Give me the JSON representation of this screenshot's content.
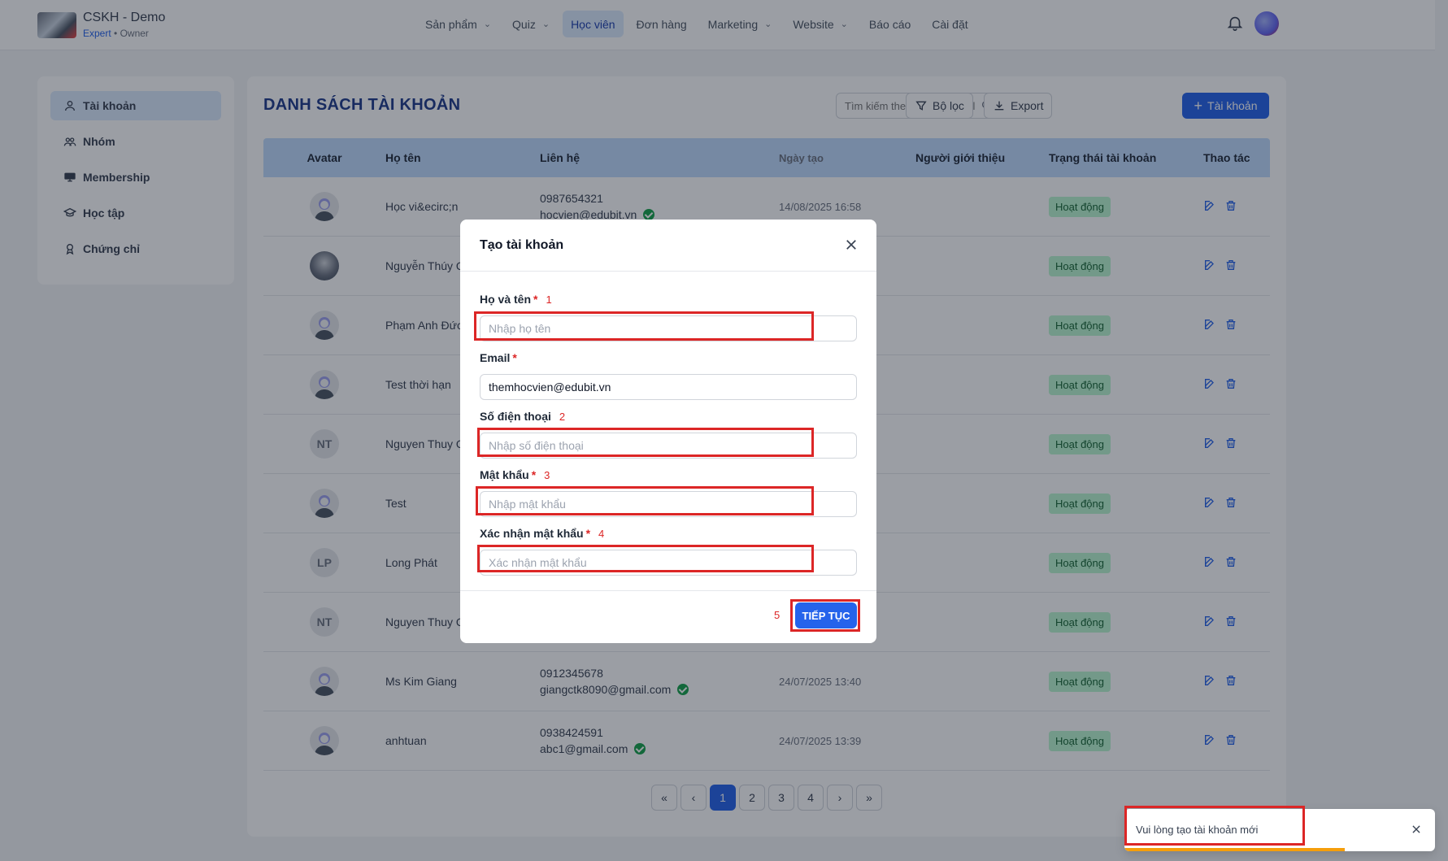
{
  "brand": {
    "name": "CSKH - Demo",
    "plan": "Expert",
    "separator": " • ",
    "role": "Owner"
  },
  "nav": [
    {
      "label": "Sản phẩm",
      "dropdown": true
    },
    {
      "label": "Quiz",
      "dropdown": true
    },
    {
      "label": "Học viên",
      "dropdown": false,
      "active": true
    },
    {
      "label": "Đơn hàng",
      "dropdown": false
    },
    {
      "label": "Marketing",
      "dropdown": true
    },
    {
      "label": "Website",
      "dropdown": true
    },
    {
      "label": "Báo cáo",
      "dropdown": false
    },
    {
      "label": "Cài đặt",
      "dropdown": false
    }
  ],
  "sidebar": {
    "items": [
      {
        "label": "Tài khoản",
        "icon": "user-icon",
        "active": true
      },
      {
        "label": "Nhóm",
        "icon": "users-icon"
      },
      {
        "label": "Membership",
        "icon": "card-icon"
      },
      {
        "label": "Học tập",
        "icon": "graduation-cap-icon"
      },
      {
        "label": "Chứng chỉ",
        "icon": "certificate-icon"
      }
    ]
  },
  "main": {
    "title": "DANH SÁCH TÀI KHOẢN",
    "search_placeholder": "Tìm kiếm theo họ tên, email",
    "filter_label": "Bộ lọc",
    "export_label": "Export",
    "add_label": "Tài khoản"
  },
  "table": {
    "headers": [
      "Avatar",
      "Họ tên",
      "Liên hệ",
      "Ngày tạo",
      "Người giới thiệu",
      "Trạng thái tài khoản",
      "Thao tác"
    ],
    "rows": [
      {
        "avatar": "default",
        "name": "Học vi&ecirc;n",
        "phone": "0987654321",
        "email": "hocvien@edubit.vn",
        "verified": true,
        "date": "14/08/2025 16:58",
        "status": "Hoạt động"
      },
      {
        "avatar": "photo",
        "name": "Nguyễn Thúy Qu",
        "phone": "",
        "email": "",
        "verified": false,
        "date": "",
        "status": "Hoạt động"
      },
      {
        "avatar": "default",
        "name": "Phạm Anh Đức",
        "phone": "",
        "email": "",
        "verified": false,
        "date": "",
        "status": "Hoạt động"
      },
      {
        "avatar": "default",
        "name": "Test thời hạn",
        "phone": "",
        "email": "",
        "verified": false,
        "date": "",
        "status": "Hoạt động"
      },
      {
        "avatar": "initials",
        "initials": "NT",
        "name": "Nguyen Thuy Qu",
        "phone": "",
        "email": "",
        "verified": false,
        "date": "",
        "status": "Hoạt động"
      },
      {
        "avatar": "default",
        "name": "Test",
        "phone": "",
        "email": "",
        "verified": false,
        "date": "",
        "status": "Hoạt động"
      },
      {
        "avatar": "initials",
        "initials": "LP",
        "name": "Long Phát",
        "phone": "",
        "email": "",
        "verified": false,
        "date": "",
        "status": "Hoạt động"
      },
      {
        "avatar": "initials",
        "initials": "NT",
        "name": "Nguyen Thuy Qu",
        "phone": "",
        "email": "",
        "verified": false,
        "date": "",
        "status": "Hoạt động"
      },
      {
        "avatar": "default",
        "name": "Ms Kim Giang",
        "phone": "0912345678",
        "email": "giangctk8090@gmail.com",
        "verified": true,
        "date": "24/07/2025 13:40",
        "status": "Hoạt động"
      },
      {
        "avatar": "default",
        "name": "anhtuan",
        "phone": "0938424591",
        "email": "abc1@gmail.com",
        "verified": true,
        "date": "24/07/2025 13:39",
        "status": "Hoạt động"
      }
    ]
  },
  "pagination": {
    "pages": [
      "1",
      "2",
      "3",
      "4"
    ],
    "current": "1"
  },
  "modal": {
    "title": "Tạo tài khoản",
    "fields": {
      "name": {
        "label": "Họ và tên",
        "required": "*",
        "step": "1",
        "placeholder": "Nhập họ tên",
        "value": ""
      },
      "email": {
        "label": "Email",
        "required": "*",
        "placeholder": "",
        "value": "themhocvien@edubit.vn"
      },
      "phone": {
        "label": "Số điện thoại",
        "step": "2",
        "placeholder": "Nhập số điện thoại",
        "value": ""
      },
      "password": {
        "label": "Mật khẩu",
        "required": "*",
        "step": "3",
        "placeholder": "Nhập mật khẩu",
        "value": ""
      },
      "confirm": {
        "label": "Xác nhận mật khẩu",
        "required": "*",
        "step": "4",
        "placeholder": "Xác nhận mật khẩu",
        "value": ""
      }
    },
    "submit_label": "TIẾP TỤC",
    "submit_step": "5"
  },
  "toast": {
    "message": "Vui lòng tạo tài khoản mới",
    "progress": 0.71
  },
  "colors": {
    "primary": "#2563eb",
    "highlight": "#dc2626",
    "status_bg": "#bbf7d0",
    "warning": "#f59e0b"
  }
}
